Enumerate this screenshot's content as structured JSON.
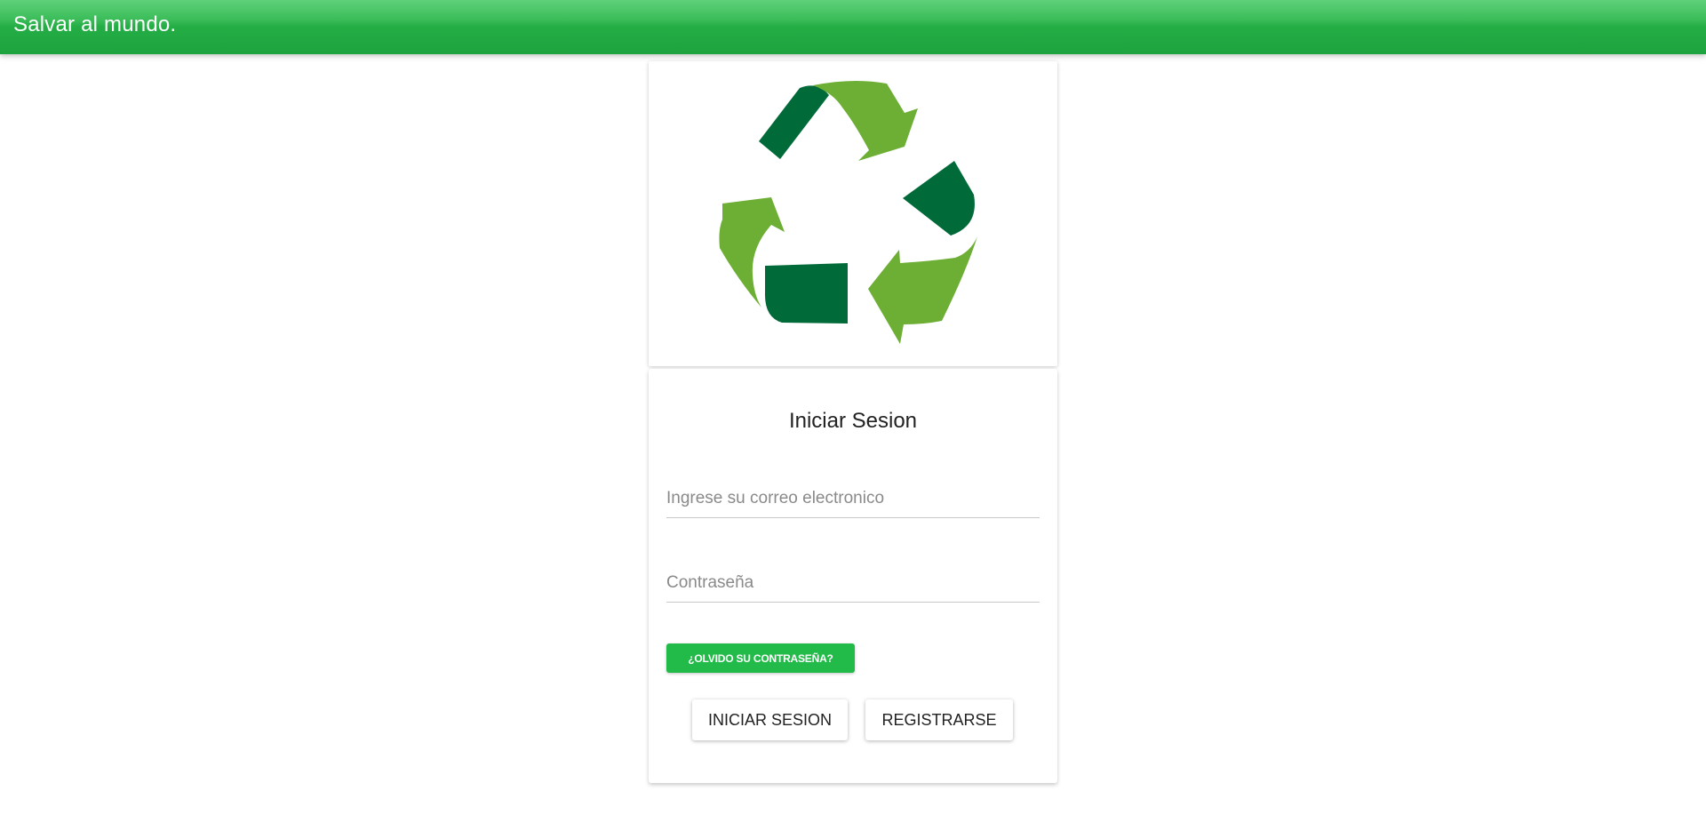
{
  "header": {
    "title": "Salvar al mundo."
  },
  "logo": {
    "icon": "recycle-icon",
    "colors": {
      "light_green": "#6dae34",
      "dark_green": "#006a38"
    }
  },
  "login": {
    "title": "Iniciar Sesion",
    "email_placeholder": "Ingrese su correo electronico",
    "password_placeholder": "Contraseña",
    "forgot_label": "¿OLVIDO SU CONTRASEÑA?",
    "login_label": "INICIAR SESION",
    "register_label": "REGISTRARSE"
  },
  "colors": {
    "header_green": "#24ad45",
    "button_green": "#22ba48"
  }
}
